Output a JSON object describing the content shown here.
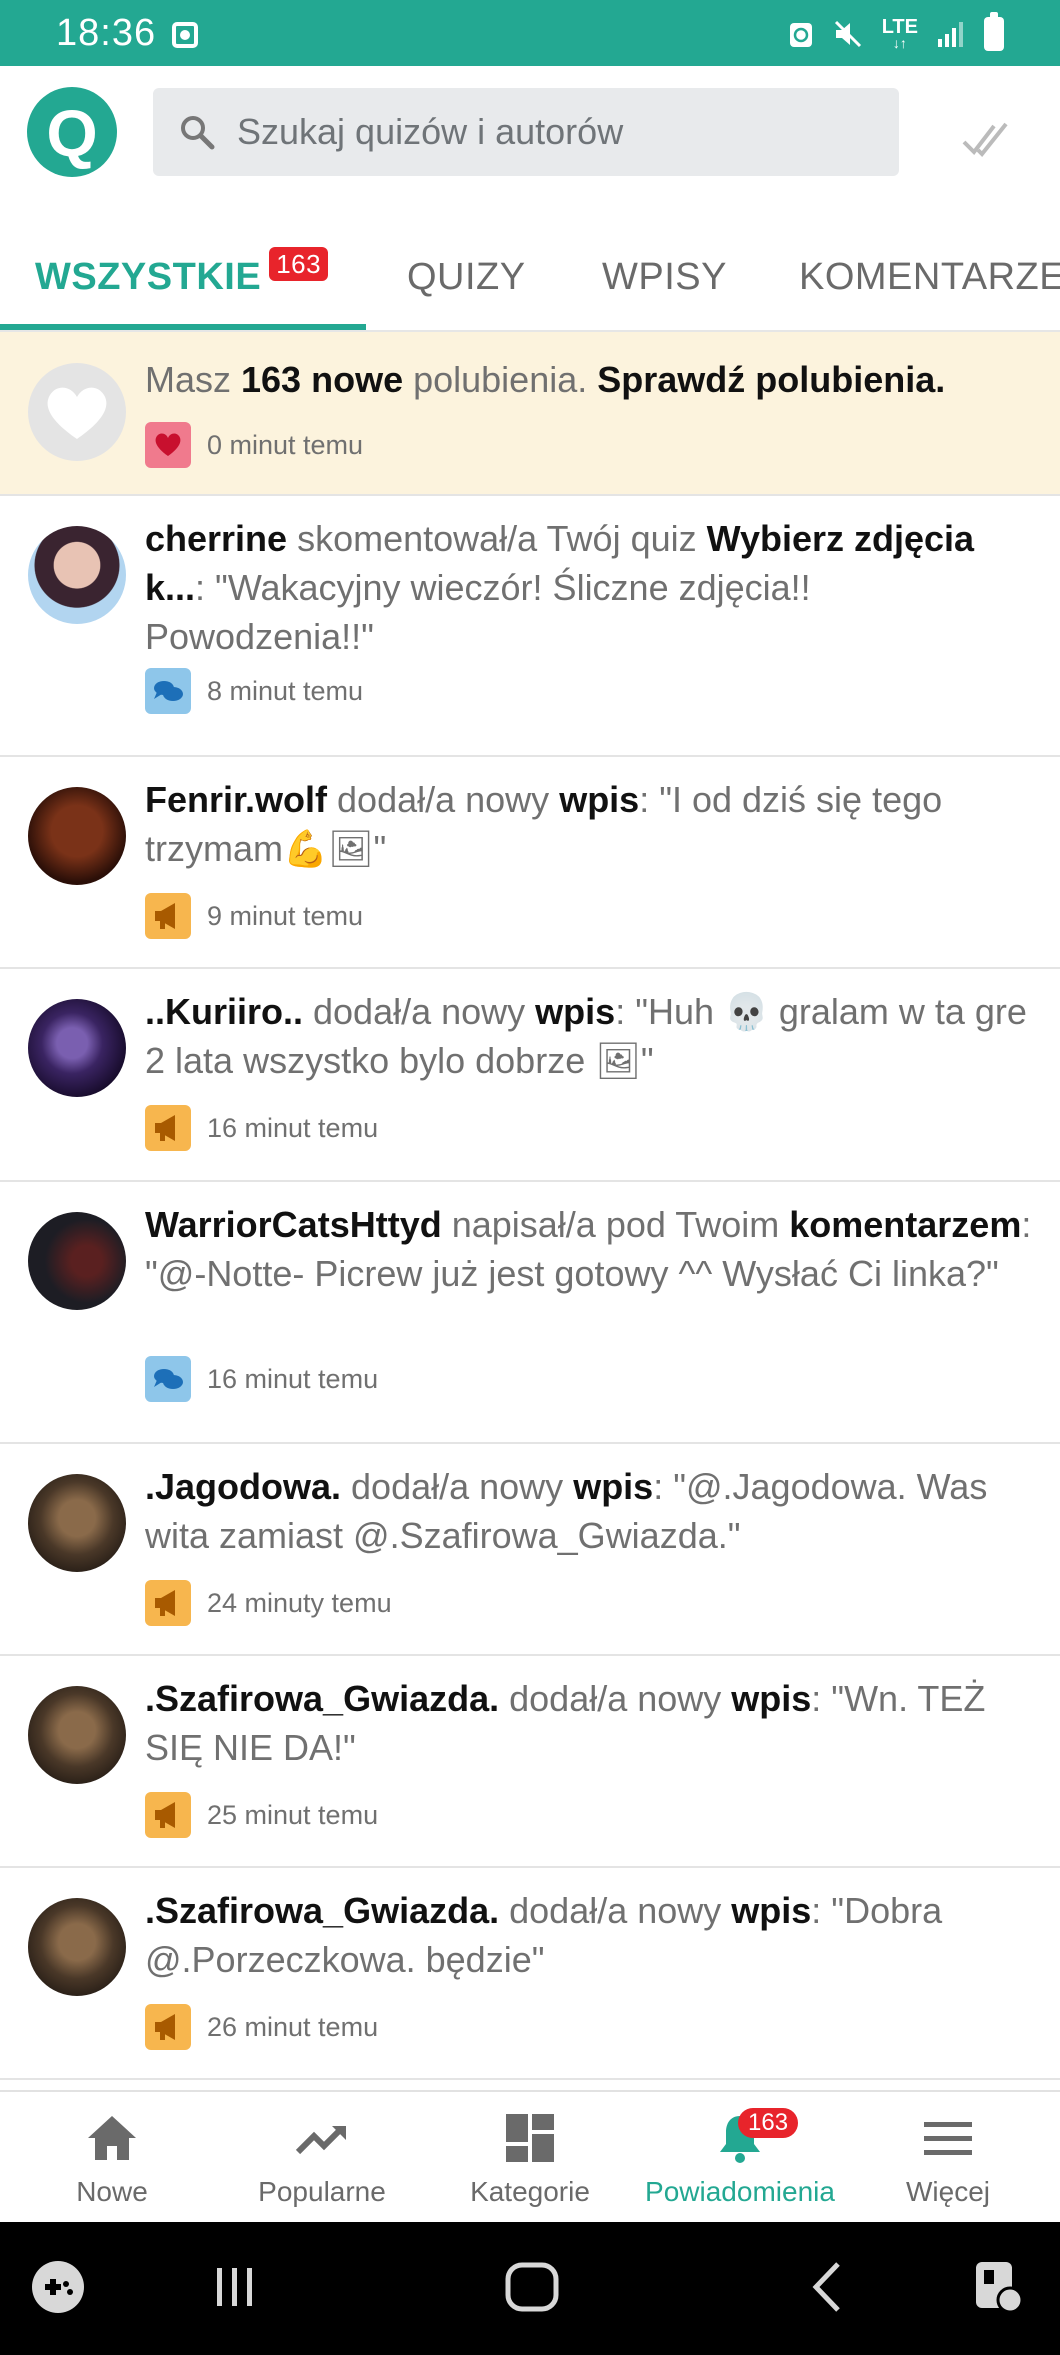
{
  "status_bar": {
    "time": "18:36",
    "network": "LTE",
    "icons": [
      "gallery-icon",
      "recycle-icon",
      "mute-icon",
      "lte-icon",
      "signal-icon",
      "battery-icon"
    ]
  },
  "header": {
    "logo_letter": "Q",
    "search_placeholder": "Szukaj quizów i autorów",
    "accent_color": "#23a892"
  },
  "tabs": [
    {
      "label": "WSZYSTKIE",
      "badge": "163",
      "active": true
    },
    {
      "label": "QUIZY"
    },
    {
      "label": "WPISY"
    },
    {
      "label": "KOMENTARZE"
    }
  ],
  "likes_notice": {
    "prefix": "Masz ",
    "count_text": "163 nowe",
    "middle": " polubienia. ",
    "link": "Sprawdź polubienia.",
    "time": "0 minut temu"
  },
  "notifications": [
    {
      "user": "cherrine",
      "action": " skomentował/a Twój quiz ",
      "target": "Wybierz zdjęcia k...",
      "quote": ": \"Wakacyjny wieczór! Śliczne zdjęcia!! Powodzenia!!\"",
      "time": "8 minut temu",
      "type": "comment"
    },
    {
      "user": "Fenrir.wolf",
      "action": " dodał/a nowy ",
      "target": "wpis",
      "quote": ": \"I od dziś się tego trzymam💪🖼\"",
      "time": "9 minut temu",
      "type": "post"
    },
    {
      "user": "..Kuriiro..",
      "action": " dodał/a nowy ",
      "target": "wpis",
      "quote": ": \"Huh 💀 gralam w ta gre 2 lata wszystko bylo dobrze 🖼\"",
      "time": "16 minut temu",
      "type": "post"
    },
    {
      "user": "WarriorCatsHttyd",
      "action": " napisał/a pod Twoim ",
      "target": "komentarzem",
      "quote": ": \"@-Notte- Picrew już jest gotowy ^^ Wysłać Ci linka?\"",
      "time": "16 minut temu",
      "type": "comment"
    },
    {
      "user": ".Jagodowa.",
      "action": " dodał/a nowy ",
      "target": "wpis",
      "quote": ": \"@.Jagodowa. Was wita zamiast @.Szafirowa_Gwiazda.\"",
      "time": "24 minuty temu",
      "type": "post"
    },
    {
      "user": ".Szafirowa_Gwiazda.",
      "action": " dodał/a nowy ",
      "target": "wpis",
      "quote": ": \"Wn. TEŻ SIĘ NIE DA!\"",
      "time": "25 minut temu",
      "type": "post"
    },
    {
      "user": ".Szafirowa_Gwiazda.",
      "action": " dodał/a nowy ",
      "target": "wpis",
      "quote": ": \"Dobra @.Porzeczkowa. będzie\"",
      "time": "26 minut temu",
      "type": "post"
    }
  ],
  "bottom_nav": [
    {
      "label": "Nowe",
      "icon": "home-icon"
    },
    {
      "label": "Popularne",
      "icon": "trending-icon"
    },
    {
      "label": "Kategorie",
      "icon": "grid-icon"
    },
    {
      "label": "Powiadomienia",
      "icon": "bell-icon",
      "badge": "163",
      "active": true
    },
    {
      "label": "Więcej",
      "icon": "menu-icon"
    }
  ]
}
